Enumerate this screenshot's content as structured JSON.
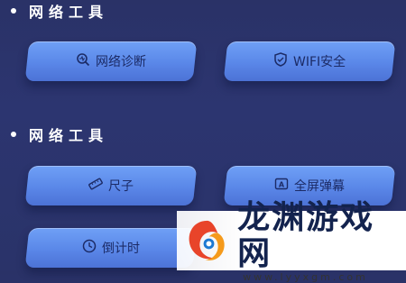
{
  "sections": [
    {
      "title": "网络工具",
      "buttons": [
        {
          "label": "网络诊断",
          "icon": "diagnose-icon"
        },
        {
          "label": "WIFI安全",
          "icon": "shield-icon"
        }
      ]
    },
    {
      "title": "网络工具",
      "buttons": [
        {
          "label": "尺子",
          "icon": "ruler-icon"
        },
        {
          "label": "全屏弹幕",
          "icon": "danmaku-icon"
        },
        {
          "label": "倒计时",
          "icon": "clock-icon"
        }
      ]
    }
  ],
  "watermark": {
    "title": "龙渊游戏网",
    "url": "www.lyyxgm.com"
  },
  "colors": {
    "background": "#2b3470",
    "button": "#5a87e8",
    "button_text": "#1c2b66"
  }
}
